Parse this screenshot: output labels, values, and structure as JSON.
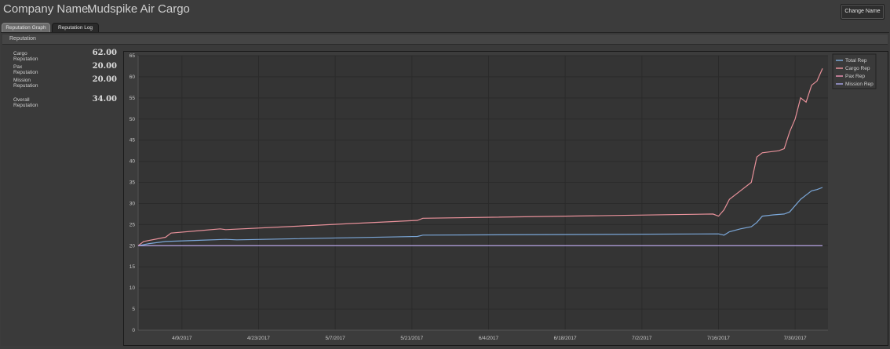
{
  "header": {
    "company_label": "Company Name:",
    "company_name": "Mudspike Air Cargo",
    "change_name_button": "Change Name"
  },
  "tabs": [
    {
      "label": "Reputation Graph",
      "active": true
    },
    {
      "label": "Reputation Log",
      "active": false
    }
  ],
  "panel": {
    "title": "Reputation",
    "stats": [
      {
        "label": "Cargo Reputation",
        "value": "62.00"
      },
      {
        "label": "Pax Reputation",
        "value": "20.00"
      },
      {
        "label": "Mission Reputation",
        "value": "20.00"
      },
      {
        "label": "Overall Reputation",
        "value": "34.00"
      }
    ]
  },
  "colors": {
    "background": "#3c3c3c",
    "plot_background": "#343434",
    "total_rep": "#7ba7d8",
    "cargo_rep": "#e8919a",
    "pax_rep": "#e88fb0",
    "mission_rep": "#a3a0e0"
  },
  "chart_data": {
    "type": "line",
    "ylim": [
      0,
      65
    ],
    "y_ticks": [
      "0",
      "5",
      "10",
      "15",
      "20",
      "25",
      "30",
      "35",
      "40",
      "45",
      "50",
      "55",
      "60",
      "65"
    ],
    "x_ticks": [
      "4/9/2017",
      "4/23/2017",
      "5/7/2017",
      "5/21/2017",
      "6/4/2017",
      "6/18/2017",
      "7/2/2017",
      "7/16/2017",
      "7/30/2017"
    ],
    "x_tick_days": [
      8,
      22,
      36,
      50,
      64,
      78,
      92,
      106,
      120
    ],
    "grid": true,
    "legend_position": "top-right",
    "series": [
      {
        "name": "Total Rep",
        "color": "#7ba7d8",
        "x": [
          0,
          2,
          5,
          16,
          18,
          51,
          52,
          106,
          107,
          108,
          110,
          112,
          113,
          114,
          116,
          118,
          119,
          120,
          121,
          122,
          123,
          124,
          125
        ],
        "y": [
          20,
          20.5,
          21,
          21.5,
          21.4,
          22.2,
          22.5,
          22.8,
          22.5,
          23.3,
          24,
          24.5,
          25.5,
          27,
          27.3,
          27.5,
          28,
          29.5,
          31,
          32,
          33,
          33.3,
          33.8
        ]
      },
      {
        "name": "Cargo Rep",
        "color": "#e8919a",
        "x": [
          0,
          1,
          5,
          6,
          15,
          16,
          51,
          52,
          105,
          106,
          107,
          108,
          110,
          112,
          113,
          114,
          117,
          118,
          119,
          120,
          121,
          122,
          123,
          124,
          125
        ],
        "y": [
          20,
          21,
          22,
          23,
          24,
          23.8,
          26,
          26.5,
          27.5,
          27,
          28.5,
          31,
          33,
          35,
          41,
          42,
          42.5,
          43,
          47,
          50,
          55,
          54,
          58,
          59,
          62
        ]
      },
      {
        "name": "Pax Rep",
        "color": "#e88fb0",
        "x": [
          0,
          125
        ],
        "y": [
          20,
          20
        ]
      },
      {
        "name": "Mission Rep",
        "color": "#a3a0e0",
        "x": [
          0,
          125
        ],
        "y": [
          20,
          20
        ]
      }
    ]
  }
}
